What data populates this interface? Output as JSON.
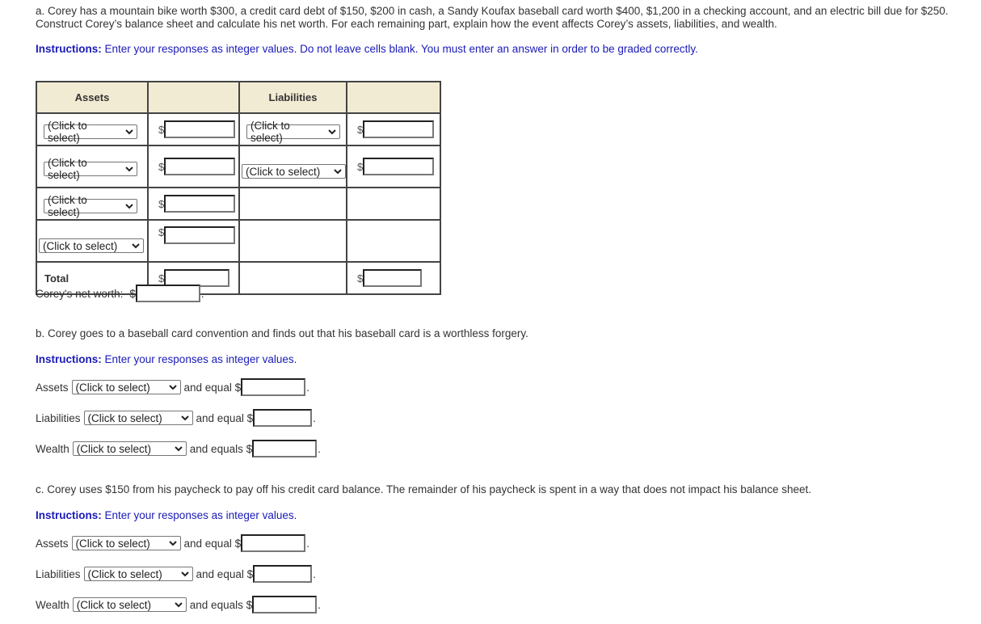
{
  "part_a": {
    "question": "a.  Corey has a mountain bike worth $300, a credit card debt of $150, $200 in cash, a Sandy Koufax baseball card worth $400, $1,200 in a checking account, and an electric bill due for $250. Construct Corey’s balance sheet and calculate his net worth. For each remaining part, explain how the event affects Corey’s assets, liabilities, and wealth.",
    "instructions_label": "Instructions:",
    "instructions_text": " Enter your responses as integer values. Do not leave cells blank. You must enter an answer in order to be graded correctly.",
    "table": {
      "headers": [
        "Assets",
        "",
        "Liabilities",
        ""
      ],
      "select_placeholder": "(Click to select)",
      "currency": "$",
      "total_label": "Total",
      "asset_rows": 4,
      "liability_rows": 2
    },
    "net_worth_label": "Corey's net worth:",
    "net_worth_value": ""
  },
  "part_b": {
    "question": "b.  Corey goes to a baseball card convention and finds out that his baseball card is a worthless forgery.",
    "instructions_label": "Instructions:",
    "instructions_text": "  Enter your responses as integer values.",
    "rows": [
      {
        "label": "Assets",
        "select": "(Click to select)",
        "suffix": "and equal $",
        "value": ""
      },
      {
        "label": "Liabilities",
        "select": "(Click to select)",
        "suffix": "and equal $",
        "value": ""
      },
      {
        "label": "Wealth",
        "select": "(Click to select)",
        "suffix": "and equals $",
        "value": ""
      }
    ]
  },
  "part_c": {
    "question": "c.  Corey uses $150 from his paycheck to pay off his credit card balance. The remainder of his paycheck is spent in a way that does not impact his balance sheet.",
    "instructions_label": "Instructions:",
    "instructions_text": "  Enter your responses as integer values.",
    "rows": [
      {
        "label": "Assets",
        "select": "(Click to select)",
        "suffix": "and equal $",
        "value": ""
      },
      {
        "label": "Liabilities",
        "select": "(Click to select)",
        "suffix": "and equal $",
        "value": ""
      },
      {
        "label": "Wealth",
        "select": "(Click to select)",
        "suffix": "and equals $",
        "value": ""
      }
    ]
  },
  "punctuation": {
    "period": "."
  }
}
